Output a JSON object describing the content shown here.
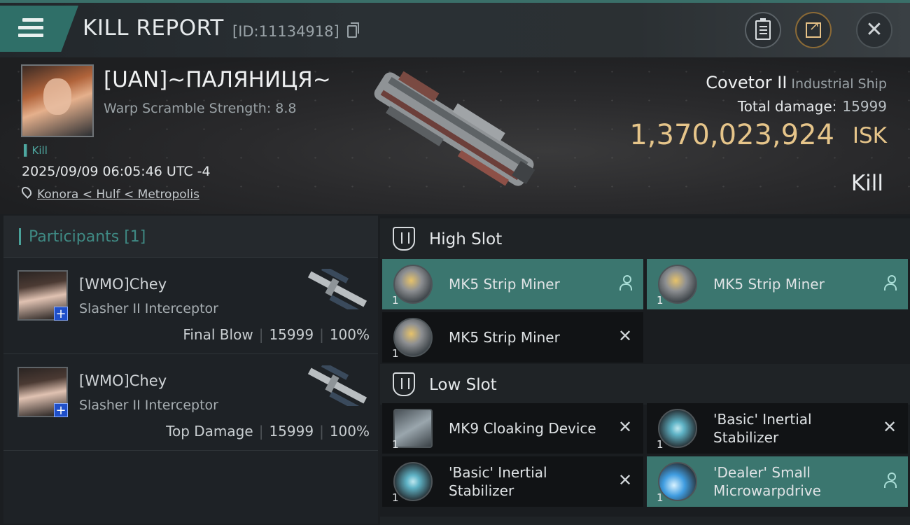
{
  "header": {
    "title": "KILL REPORT",
    "report_id": "[ID:11134918]"
  },
  "victim": {
    "name": "[UAN]~ПАЛЯНИЦЯ~",
    "warp_scramble": "Warp Scramble Strength: 8.8",
    "kill_tag": "Kill",
    "datetime": "2025/09/09 06:05:46 UTC -4",
    "location": "Konora < Hulf < Metropolis",
    "ship": "Covetor II",
    "ship_class": "Industrial Ship",
    "total_damage_label": "Total damage:",
    "total_damage": "15999",
    "isk_value": "1,370,023,924",
    "isk_unit": "ISK",
    "result": "Kill"
  },
  "participants": {
    "label": "Participants [1]",
    "rows": [
      {
        "name": "[WMO]Chey",
        "ship": "Slasher II Interceptor",
        "role": "Final Blow",
        "damage": "15999",
        "percent": "100%"
      },
      {
        "name": "[WMO]Chey",
        "ship": "Slasher II Interceptor",
        "role": "Top Damage",
        "damage": "15999",
        "percent": "100%"
      }
    ]
  },
  "slots": {
    "high": {
      "label": "High Slot",
      "modules": [
        {
          "name": "MK5 Strip Miner",
          "qty": "1",
          "status": "dropped"
        },
        {
          "name": "MK5 Strip Miner",
          "qty": "1",
          "status": "dropped"
        },
        {
          "name": "MK5 Strip Miner",
          "qty": "1",
          "status": "destroyed"
        }
      ]
    },
    "low": {
      "label": "Low Slot",
      "modules": [
        {
          "name": "MK9 Cloaking Device",
          "qty": "1",
          "status": "destroyed"
        },
        {
          "name": "'Basic' Inertial Stabilizer",
          "qty": "1",
          "status": "destroyed"
        },
        {
          "name": "'Basic' Inertial Stabilizer",
          "qty": "1",
          "status": "destroyed"
        },
        {
          "name": "'Dealer' Small Microwarpdrive",
          "qty": "1",
          "status": "dropped"
        }
      ]
    }
  },
  "colors": {
    "accent_teal": "#3b766f",
    "isk_gold": "#e6c58a"
  }
}
